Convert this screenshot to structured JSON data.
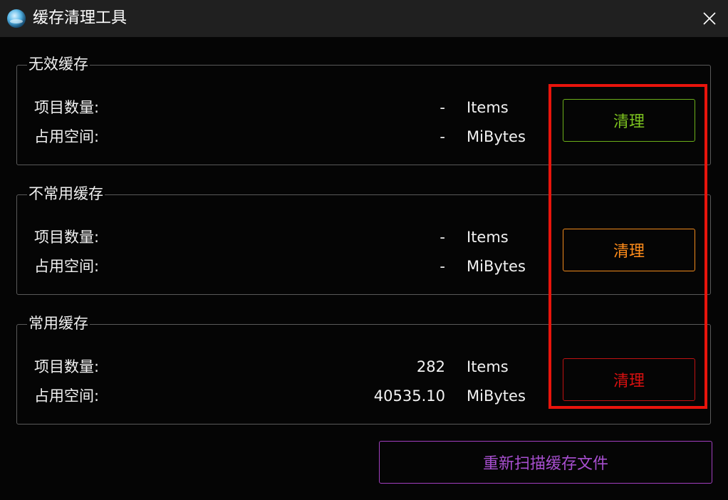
{
  "window": {
    "title": "缓存清理工具",
    "icon": "app-globe-icon"
  },
  "groups": [
    {
      "title": "无效缓存",
      "items_label": "项目数量:",
      "items_value": "-",
      "items_unit": "Items",
      "space_label": "占用空间:",
      "space_value": "-",
      "space_unit": "MiBytes",
      "button_label": "清理",
      "button_color": "#7cc21f"
    },
    {
      "title": "不常用缓存",
      "items_label": "项目数量:",
      "items_value": "-",
      "items_unit": "Items",
      "space_label": "占用空间:",
      "space_value": "-",
      "space_unit": "MiBytes",
      "button_label": "清理",
      "button_color": "#ff8c1a"
    },
    {
      "title": "常用缓存",
      "items_label": "项目数量:",
      "items_value": "282",
      "items_unit": "Items",
      "space_label": "占用空间:",
      "space_value": "40535.10",
      "space_unit": "MiBytes",
      "button_label": "清理",
      "button_color": "#d81010"
    }
  ],
  "rescan": {
    "label": "重新扫描缓存文件",
    "color": "#a84fd0"
  },
  "highlight_color": "#e8140c"
}
